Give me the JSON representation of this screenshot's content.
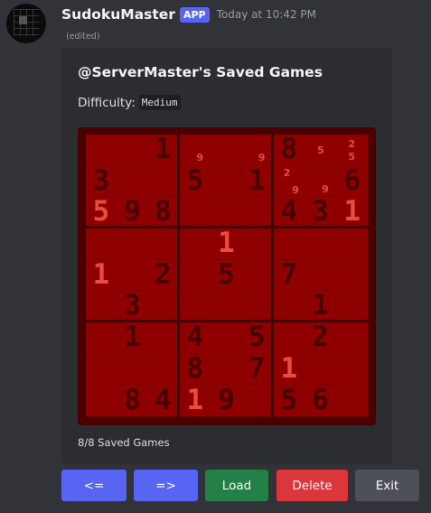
{
  "message": {
    "username": "SudokuMaster",
    "badge": "APP",
    "timestamp": "Today at 10:42 PM",
    "edited": "(edited)"
  },
  "embed": {
    "title": "@ServerMaster's Saved Games",
    "difficulty_label": "Difficulty:",
    "difficulty_value": "Medium",
    "footer": "8/8 Saved Games"
  },
  "board": {
    "colors": {
      "background": "#8f0000",
      "frame": "#4a0000",
      "given_digit": "#480000",
      "user_digit": "#e74c3c"
    },
    "cells": [
      [
        {
          "v": ""
        },
        {
          "v": ""
        },
        {
          "v": "1",
          "k": "g"
        },
        {
          "p": [
            {
              "t": "9",
              "x": 55,
              "y": 60
            }
          ]
        },
        {
          "v": ""
        },
        {
          "p": [
            {
              "t": "9",
              "x": 55,
              "y": 60
            }
          ]
        },
        {
          "v": "8",
          "k": "g"
        },
        {
          "p": [
            {
              "t": "5",
              "x": 40,
              "y": 35
            }
          ]
        },
        {
          "p": [
            {
              "t": "2",
              "x": 38,
              "y": 15
            },
            {
              "t": "5",
              "x": 38,
              "y": 55
            }
          ]
        }
      ],
      [
        {
          "v": "3",
          "k": "g"
        },
        {
          "v": ""
        },
        {
          "v": ""
        },
        {
          "v": "5",
          "k": "g"
        },
        {
          "v": ""
        },
        {
          "v": "1",
          "k": "g"
        },
        {
          "p": [
            {
              "t": "2",
              "x": 32,
              "y": 8
            },
            {
              "t": "9",
              "x": 60,
              "y": 62
            }
          ]
        },
        {
          "p": [
            {
              "t": "9",
              "x": 55,
              "y": 60
            }
          ]
        },
        {
          "v": "6",
          "k": "g"
        }
      ],
      [
        {
          "v": "5",
          "k": "u"
        },
        {
          "v": "9",
          "k": "g"
        },
        {
          "v": "8",
          "k": "g"
        },
        {
          "v": ""
        },
        {
          "v": ""
        },
        {
          "v": ""
        },
        {
          "v": "4",
          "k": "g"
        },
        {
          "v": "3",
          "k": "g"
        },
        {
          "v": "1",
          "k": "u"
        }
      ],
      [
        {
          "v": ""
        },
        {
          "v": ""
        },
        {
          "v": ""
        },
        {
          "v": ""
        },
        {
          "v": "1",
          "k": "u"
        },
        {
          "v": ""
        },
        {
          "v": ""
        },
        {
          "v": ""
        },
        {
          "v": ""
        }
      ],
      [
        {
          "v": "1",
          "k": "u"
        },
        {
          "v": ""
        },
        {
          "v": "2",
          "k": "g"
        },
        {
          "v": ""
        },
        {
          "v": "5",
          "k": "g"
        },
        {
          "v": ""
        },
        {
          "v": "7",
          "k": "g"
        },
        {
          "v": ""
        },
        {
          "v": ""
        }
      ],
      [
        {
          "v": ""
        },
        {
          "v": "3",
          "k": "g"
        },
        {
          "v": ""
        },
        {
          "v": ""
        },
        {
          "v": ""
        },
        {
          "v": ""
        },
        {
          "v": ""
        },
        {
          "v": "1",
          "k": "g"
        },
        {
          "v": ""
        }
      ],
      [
        {
          "v": ""
        },
        {
          "v": "1",
          "k": "g"
        },
        {
          "v": ""
        },
        {
          "v": "4",
          "k": "g"
        },
        {
          "v": ""
        },
        {
          "v": "5",
          "k": "g"
        },
        {
          "v": ""
        },
        {
          "v": "2",
          "k": "g"
        },
        {
          "v": ""
        }
      ],
      [
        {
          "v": ""
        },
        {
          "v": ""
        },
        {
          "v": ""
        },
        {
          "v": "8",
          "k": "g"
        },
        {
          "v": ""
        },
        {
          "v": "7",
          "k": "g"
        },
        {
          "v": "1",
          "k": "u"
        },
        {
          "v": ""
        },
        {
          "v": ""
        }
      ],
      [
        {
          "v": ""
        },
        {
          "v": "8",
          "k": "g"
        },
        {
          "v": "4",
          "k": "g"
        },
        {
          "v": "1",
          "k": "u"
        },
        {
          "v": "9",
          "k": "g"
        },
        {
          "v": ""
        },
        {
          "v": "5",
          "k": "g"
        },
        {
          "v": "6",
          "k": "g"
        },
        {
          "v": ""
        }
      ]
    ]
  },
  "buttons": {
    "prev": "<=",
    "next": "=>",
    "load": "Load",
    "delete": "Delete",
    "exit": "Exit"
  }
}
